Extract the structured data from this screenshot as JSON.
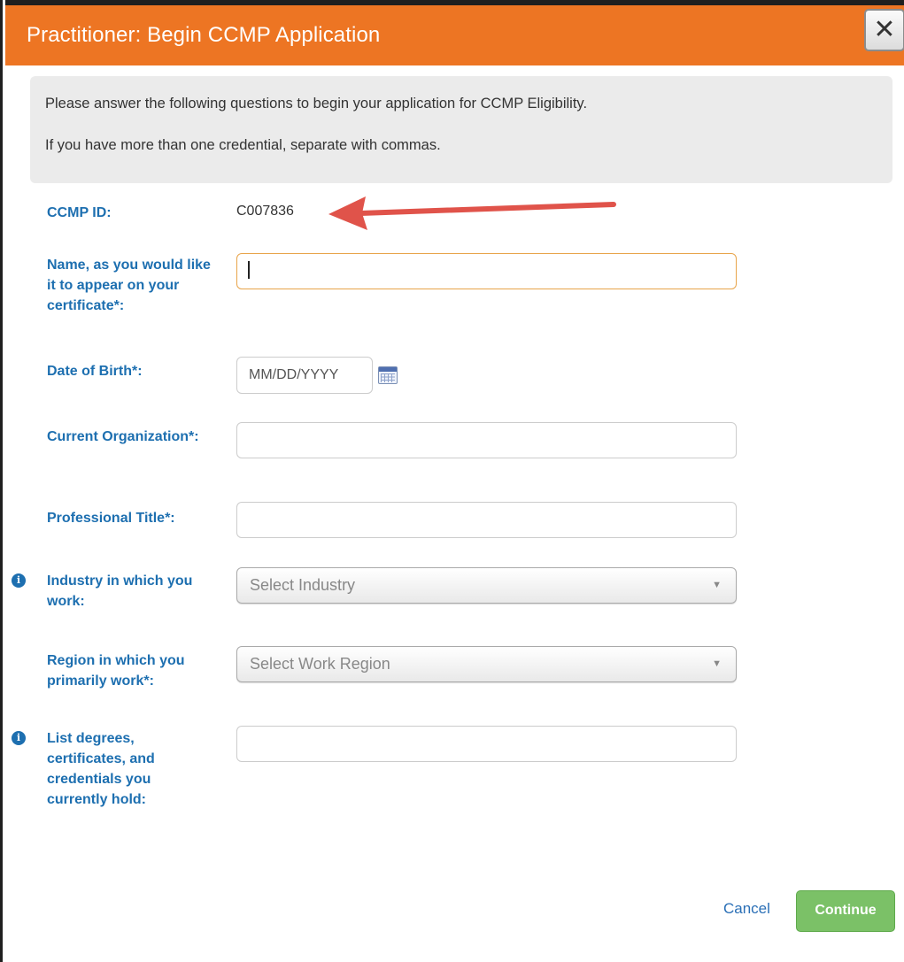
{
  "dialog": {
    "title": "Practitioner: Begin CCMP Application",
    "close_glyph": "✕"
  },
  "intro": {
    "line1": "Please answer the following questions to begin your application for CCMP Eligibility.",
    "line2": "If you have more than one credential, separate with commas."
  },
  "form": {
    "ccmp_id": {
      "label": "CCMP ID:",
      "value": "C007836"
    },
    "name": {
      "label": "Name, as you would like it to appear on your certificate*:",
      "value": ""
    },
    "dob": {
      "label": "Date of Birth*:",
      "placeholder": "MM/DD/YYYY",
      "icon": "calendar-icon"
    },
    "organization": {
      "label": "Current Organization*:",
      "value": ""
    },
    "title": {
      "label": "Professional Title*:",
      "value": ""
    },
    "industry": {
      "label": "Industry in which you work:",
      "selected": "Select Industry",
      "info_icon": "info-icon"
    },
    "region": {
      "label": "Region in which you primarily work*:",
      "selected": "Select Work Region"
    },
    "credentials": {
      "label": "List degrees, certificates, and credentials you currently hold:",
      "value": "",
      "info_icon": "info-icon"
    }
  },
  "actions": {
    "cancel_label": "Cancel",
    "continue_label": "Continue"
  },
  "colors": {
    "header_orange": "#ed7523",
    "label_blue": "#1d6fb0",
    "continue_green": "#7bc167",
    "annotation_arrow": "#e0534a"
  }
}
